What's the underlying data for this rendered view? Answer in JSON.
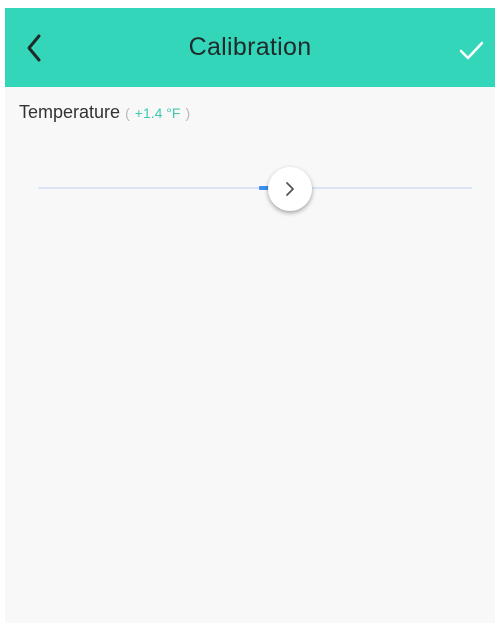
{
  "header": {
    "title": "Calibration",
    "back_icon": "chevron-left-icon",
    "confirm_icon": "checkmark-icon",
    "background_color": "#33d6b9"
  },
  "temperature": {
    "label": "Temperature",
    "paren_open": "(",
    "value": "+1.4 °F",
    "paren_close": ")",
    "slider_position_fraction": 0.58,
    "fill_start_fraction": 0.51,
    "thumb_icon": "chevron-right-icon",
    "accent_color": "#3b8ff0",
    "value_color": "#40c9b0"
  }
}
